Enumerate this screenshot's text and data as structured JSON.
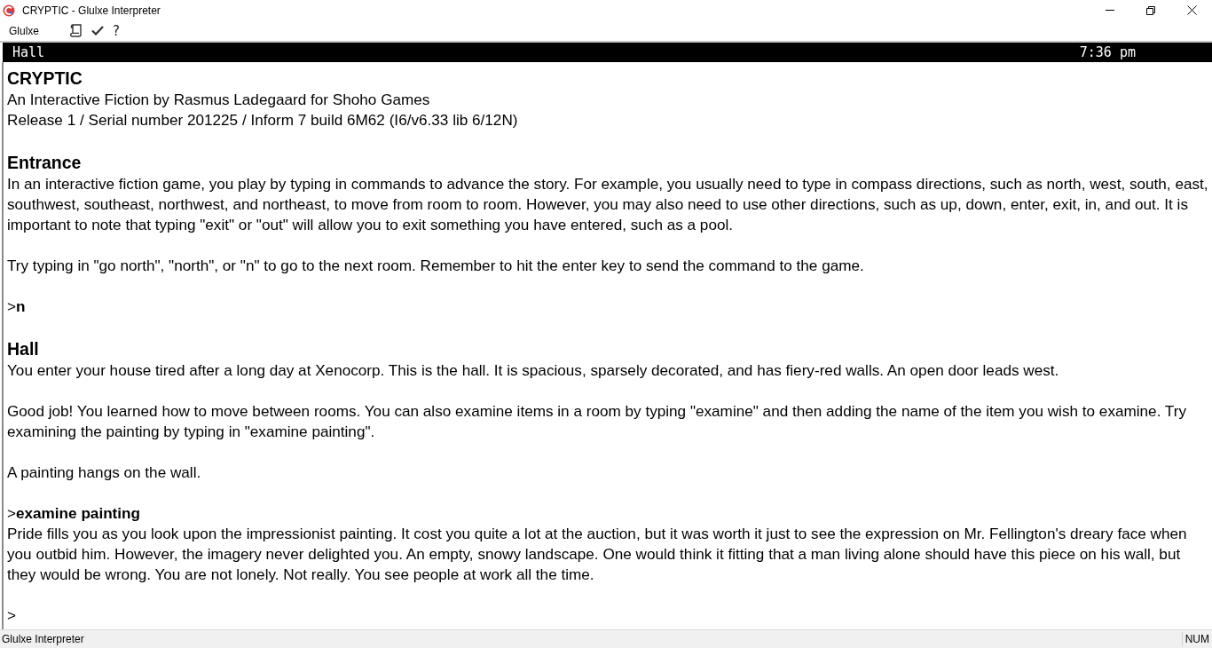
{
  "window": {
    "title": "CRYPTIC - Glulxe Interpreter"
  },
  "menu_bar": {
    "items": [
      "Glulxe"
    ]
  },
  "toolbar": [
    {
      "kind": "scroll"
    },
    {
      "kind": "check"
    },
    {
      "kind": "text",
      "label": "?"
    }
  ],
  "status_line": {
    "location": "Hall",
    "time": "7:36 pm"
  },
  "story": [
    {
      "lines": [
        {
          "kind": "heading",
          "text": "CRYPTIC"
        },
        {
          "kind": "text",
          "text": "An Interactive Fiction by Rasmus Ladegaard for Shoho Games"
        },
        {
          "kind": "text",
          "text": "Release 1 / Serial number 201225 / Inform 7 build 6M62 (I6/v6.33 lib 6/12N)"
        }
      ]
    },
    {
      "lines": [
        {
          "kind": "heading",
          "text": "Entrance"
        },
        {
          "kind": "text",
          "text": "In an interactive fiction game, you play by typing in commands to advance the story. For example, you usually need to type in compass directions, such as north, west, south, east, southwest, southeast, northwest, and northeast, to move from room to room. However, you may also need to use other directions, such as up, down, enter, exit, in, and out. It is important to note that typing \"exit\" or \"out\" will allow you to exit something you have entered, such as a pool."
        }
      ]
    },
    {
      "lines": [
        {
          "kind": "text",
          "text": "Try typing in \"go north\", \"north\", or \"n\" to go to the next room. Remember to hit the enter key to send the command to the game."
        }
      ]
    },
    {
      "lines": [
        {
          "kind": "command",
          "text": ">**n**"
        }
      ]
    },
    {
      "lines": [
        {
          "kind": "heading",
          "text": "Hall"
        },
        {
          "kind": "text",
          "text": "You enter your house tired after a long day at Xenocorp. This is the hall. It is spacious, sparsely decorated, and has fiery-red walls. An open door leads west."
        }
      ]
    },
    {
      "lines": [
        {
          "kind": "text",
          "text": "Good job! You learned how to move between rooms. You can also examine items in a room by typing \"examine\" and then adding the name of the item you wish to examine. Try examining the painting by typing in \"examine painting\"."
        }
      ]
    },
    {
      "lines": [
        {
          "kind": "text",
          "text": "A painting hangs on the wall."
        }
      ]
    },
    {
      "lines": [
        {
          "kind": "command",
          "text": ">**examine painting**"
        },
        {
          "kind": "text",
          "text": "Pride fills you as you look upon the impressionist painting. It cost you quite a lot at the auction, but it was worth it just to see the expression on Mr. Fellington's dreary face when you outbid him. However, the imagery never delighted you. An empty, snowy landscape. One would think it fitting that a man living alone should have this piece on his wall, but they would be wrong. You are not lonely. Not really. You see people at work all the time."
        }
      ]
    },
    {
      "lines": [
        {
          "kind": "prompt",
          "text": ">"
        }
      ]
    }
  ],
  "status_bar": {
    "text": "Glulxe Interpreter",
    "indicator": "NUM"
  }
}
